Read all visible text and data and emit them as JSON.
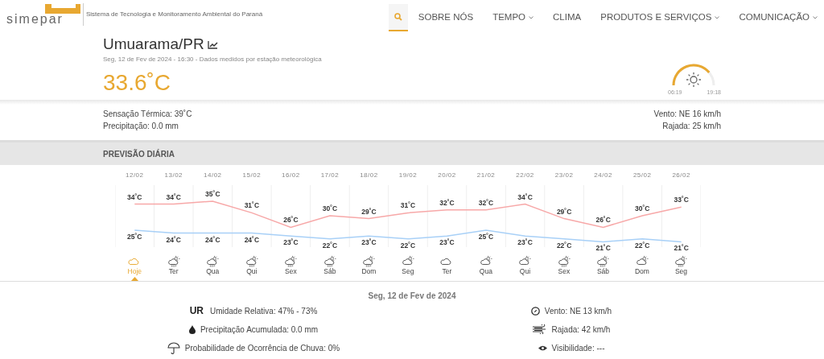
{
  "header": {
    "logo_text": "simepar",
    "tagline": "Sistema de Tecnologia e Monitoramento Ambiental do Paraná"
  },
  "nav": [
    {
      "kind": "search",
      "selected": true
    },
    {
      "kind": "link",
      "label": "SOBRE NÓS",
      "has_menu": false
    },
    {
      "kind": "link",
      "label": "TEMPO",
      "has_menu": true
    },
    {
      "kind": "link",
      "label": "CLIMA",
      "has_menu": false
    },
    {
      "kind": "link",
      "label": "PRODUTOS E SERVIÇOS",
      "has_menu": true
    },
    {
      "kind": "link",
      "label": "COMUNICAÇÃO",
      "has_menu": true
    }
  ],
  "station": {
    "city": "Umuarama/PR",
    "subtitle": "Seg, 12 de Fev de 2024 - 16:30 - Dados medidos por estação meteorológica",
    "temperature": "33.6˚C"
  },
  "sun": {
    "level": 0.78,
    "sunrise": "06:19",
    "sunset": "19:18"
  },
  "conditions": {
    "left": [
      "Sensação Térmica: 39˚C",
      "Precipitação: 0.0 mm"
    ],
    "right": [
      "Vento: NE 16 km/h",
      "Rajada: 25 km/h"
    ]
  },
  "section_title": "PREVISÃO DIÁRIA",
  "chart_data": {
    "type": "line",
    "categories": [
      "12/02",
      "13/02",
      "14/02",
      "15/02",
      "16/02",
      "17/02",
      "18/02",
      "19/02",
      "20/02",
      "21/02",
      "22/02",
      "23/02",
      "24/02",
      "25/02",
      "26/02"
    ],
    "series": [
      {
        "color": "#f7a8a8",
        "values": [
          34,
          34,
          35,
          31,
          26,
          30,
          29,
          31,
          32,
          32,
          34,
          29,
          26,
          30,
          33
        ],
        "value_labels": [
          "34˚C",
          "34˚C",
          "35˚C",
          "31˚C",
          "26˚C",
          "30˚C",
          "29˚C",
          "31˚C",
          "32˚C",
          "32˚C",
          "34˚C",
          "29˚C",
          "26˚C",
          "30˚C",
          "33˚C"
        ]
      },
      {
        "color": "#a8d0f7",
        "values": [
          25,
          24,
          24,
          24,
          23,
          22,
          23,
          22,
          23,
          25,
          23,
          22,
          21,
          22,
          21
        ],
        "value_labels": [
          "25˚C",
          "24˚C",
          "24˚C",
          "24˚C",
          "23˚C",
          "22˚C",
          "23˚C",
          "22˚C",
          "23˚C",
          "25˚C",
          "23˚C",
          "22˚C",
          "21˚C",
          "22˚C",
          "21˚C"
        ]
      }
    ],
    "data_labels": true
  },
  "days": [
    {
      "weekday": "Hoje",
      "kind": "cloud",
      "selected": true
    },
    {
      "weekday": "Ter",
      "kind": "rain-sun",
      "selected": false
    },
    {
      "weekday": "Qua",
      "kind": "rain-sun",
      "selected": false
    },
    {
      "weekday": "Qui",
      "kind": "rain-sun",
      "selected": false
    },
    {
      "weekday": "Sex",
      "kind": "rain-sun",
      "selected": false
    },
    {
      "weekday": "Sáb",
      "kind": "rain-sun",
      "selected": false
    },
    {
      "weekday": "Dom",
      "kind": "rain-sun",
      "selected": false
    },
    {
      "weekday": "Seg",
      "kind": "cloud-sun",
      "selected": false
    },
    {
      "weekday": "Ter",
      "kind": "cloud",
      "selected": false
    },
    {
      "weekday": "Qua",
      "kind": "cloud-sun",
      "selected": false
    },
    {
      "weekday": "Qui",
      "kind": "cloud-sun",
      "selected": false
    },
    {
      "weekday": "Sex",
      "kind": "rain-sun",
      "selected": false
    },
    {
      "weekday": "Sáb",
      "kind": "rain-sun",
      "selected": false
    },
    {
      "weekday": "Dom",
      "kind": "cloud-sun",
      "selected": false
    },
    {
      "weekday": "Seg",
      "kind": "rain-sun",
      "selected": false
    }
  ],
  "detail": {
    "date": "Seg, 12 de Fev de 2024",
    "left": [
      {
        "kind": "badge",
        "badge": "UR",
        "text": "Umidade Relativa: 47% - 73%"
      },
      {
        "kind": "drop",
        "text": "Precipitação Acumulada: 0.0 mm"
      },
      {
        "kind": "umbrella",
        "text": "Probabilidade de Ocorrência de Chuva: 0%"
      }
    ],
    "right": [
      {
        "kind": "compass",
        "text": "Vento: NE 13 km/h"
      },
      {
        "kind": "wind",
        "text": "Rajada: 42 km/h"
      },
      {
        "kind": "eye",
        "text": "Visibilidade: ---"
      }
    ]
  }
}
